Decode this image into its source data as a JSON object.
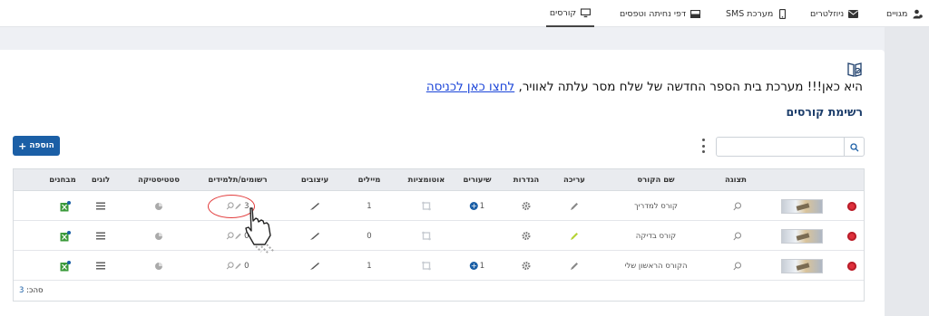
{
  "nav": {
    "items": [
      {
        "label": "מגויים",
        "icon": "user-cog-icon"
      },
      {
        "label": "ניוזלטרים",
        "icon": "envelope-icon"
      },
      {
        "label": "מערכת SMS",
        "icon": "mobile-icon"
      },
      {
        "label": "דפי נחיתה וטפסים",
        "icon": "window-icon"
      },
      {
        "label": "קורסים",
        "icon": "monitor-icon"
      }
    ],
    "active_index": 4
  },
  "notice": {
    "text": "היא כאן!!! מערכת בית הספר החדשה של שלח מסר עלתה לאוויר, ",
    "link": "לחצו כאן לכניסה"
  },
  "section": {
    "title": "רשימת קורסים"
  },
  "toolbar": {
    "add_label": "הוספה",
    "search_placeholder": ""
  },
  "table": {
    "columns": [
      {
        "key": "delete",
        "label": ""
      },
      {
        "key": "thumb",
        "label": ""
      },
      {
        "key": "preview",
        "label": "תצוגה"
      },
      {
        "key": "name",
        "label": "שם הקורס"
      },
      {
        "key": "edit",
        "label": "עריכה"
      },
      {
        "key": "settings",
        "label": "הגדרות"
      },
      {
        "key": "lessons",
        "label": "שיעורים"
      },
      {
        "key": "automations",
        "label": "אוטומציות"
      },
      {
        "key": "emails",
        "label": "מיילים"
      },
      {
        "key": "design",
        "label": "עיצובים"
      },
      {
        "key": "registered",
        "label": "רשומים/תלמידים"
      },
      {
        "key": "stats",
        "label": "סטטיסטיקה"
      },
      {
        "key": "logs",
        "label": "לוגים"
      },
      {
        "key": "tests",
        "label": "מבחנים"
      }
    ],
    "rows": [
      {
        "name": "קורס למדריך",
        "lessons": "1",
        "emails": "1",
        "registered": "3",
        "edit_color": "#888888"
      },
      {
        "name": "קורס בדיקה",
        "lessons": "",
        "emails": "0",
        "registered": "0",
        "edit_color": "#b5d334"
      },
      {
        "name": "הקורס הראשון שלי",
        "lessons": "1",
        "emails": "1",
        "registered": "0",
        "edit_color": "#888888"
      }
    ],
    "total_label": "סהכ:",
    "total_value": "3"
  },
  "colors": {
    "accent": "#1b5fa6",
    "title": "#1d3e6b",
    "link": "#1a44d8",
    "delete": "#e0303c",
    "highlight": "#e23b3b"
  }
}
